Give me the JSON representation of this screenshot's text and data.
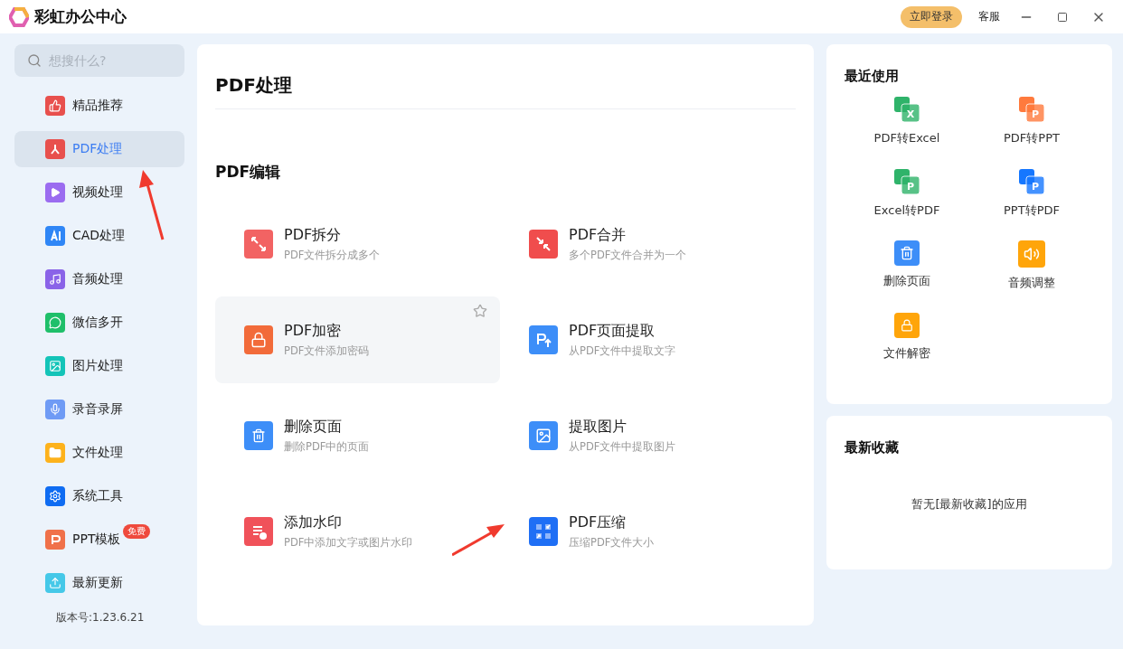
{
  "window": {
    "title": "彩虹办公中心",
    "login": "立即登录",
    "support": "客服"
  },
  "search": {
    "placeholder": "想搜什么?"
  },
  "sidebar": {
    "items": [
      {
        "label": "精品推荐",
        "kind": "thumb",
        "color": "#e8504d",
        "selected": false
      },
      {
        "label": "PDF处理",
        "kind": "pdf",
        "color": "#e8504d",
        "selected": true
      },
      {
        "label": "视频处理",
        "kind": "play",
        "color": "#9b6cf0",
        "selected": false
      },
      {
        "label": "CAD处理",
        "kind": "cad",
        "color": "#2f86f6",
        "selected": false
      },
      {
        "label": "音频处理",
        "kind": "music",
        "color": "#8a63e8",
        "selected": false
      },
      {
        "label": "微信多开",
        "kind": "chat",
        "color": "#1fbf6a",
        "selected": false
      },
      {
        "label": "图片处理",
        "kind": "image",
        "color": "#14c4b8",
        "selected": false
      },
      {
        "label": "录音录屏",
        "kind": "mic",
        "color": "#6f9bf5",
        "selected": false
      },
      {
        "label": "文件处理",
        "kind": "folder",
        "color": "#fdb21c",
        "selected": false
      },
      {
        "label": "系统工具",
        "kind": "gear",
        "color": "#0f6cf2",
        "selected": false
      },
      {
        "label": "PPT模板",
        "kind": "ppt",
        "color": "#f0714a",
        "selected": false,
        "badge": "免费"
      },
      {
        "label": "最新更新",
        "kind": "upload",
        "color": "#45c8e8",
        "selected": false
      }
    ],
    "version": "版本号:1.23.6.21"
  },
  "main": {
    "title": "PDF处理",
    "section": "PDF编辑",
    "tools": [
      {
        "name": "PDF拆分",
        "desc": "PDF文件拆分成多个",
        "kind": "split",
        "highlighted": false
      },
      {
        "name": "PDF合并",
        "desc": "多个PDF文件合并为一个",
        "kind": "merge",
        "highlighted": false
      },
      {
        "name": "PDF加密",
        "desc": "PDF文件添加密码",
        "kind": "lock",
        "highlighted": true
      },
      {
        "name": "PDF页面提取",
        "desc": "从PDF文件中提取文字",
        "kind": "extract",
        "highlighted": false
      },
      {
        "name": "删除页面",
        "desc": "删除PDF中的页面",
        "kind": "delete",
        "highlighted": false
      },
      {
        "name": "提取图片",
        "desc": "从PDF文件中提取图片",
        "kind": "picture",
        "highlighted": false
      },
      {
        "name": "添加水印",
        "desc": "PDF中添加文字或图片水印",
        "kind": "watermark",
        "highlighted": false
      },
      {
        "name": "PDF压缩",
        "desc": "压缩PDF文件大小",
        "kind": "compress",
        "highlighted": false
      }
    ]
  },
  "recent": {
    "title": "最近使用",
    "items": [
      {
        "label": "PDF转Excel",
        "kind": "convert",
        "color": "#2fb36a",
        "glyph": "X"
      },
      {
        "label": "PDF转PPT",
        "kind": "convert",
        "color": "#ff7a3d",
        "glyph": "P"
      },
      {
        "label": "Excel转PDF",
        "kind": "convert",
        "color": "#2fb36a",
        "glyph": "P"
      },
      {
        "label": "PPT转PDF",
        "kind": "convert",
        "color": "#1677ff",
        "glyph": "P"
      },
      {
        "label": "删除页面",
        "kind": "delete",
        "color": "#3d8ef8"
      },
      {
        "label": "音频调整",
        "kind": "audio",
        "color": "#ffa50a"
      },
      {
        "label": "文件解密",
        "kind": "unlock",
        "color": "#ffa50a"
      }
    ]
  },
  "favorites": {
    "title": "最新收藏",
    "empty": "暂无[最新收藏]的应用"
  }
}
